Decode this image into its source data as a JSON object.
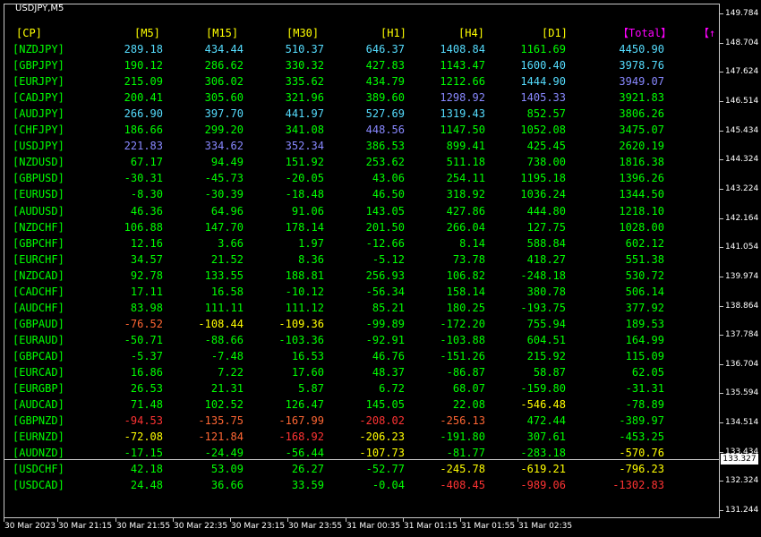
{
  "chart_title": "USDJPY,M5",
  "price_axis": [
    "149.784",
    "148.704",
    "147.624",
    "146.514",
    "145.434",
    "144.324",
    "143.224",
    "142.164",
    "141.054",
    "139.974",
    "138.864",
    "137.784",
    "136.704",
    "135.594",
    "134.514",
    "133.434",
    "132.324",
    "131.244"
  ],
  "current_price": "133.327",
  "time_axis": [
    "30 Mar 2023",
    "30 Mar 21:15",
    "30 Mar 21:55",
    "30 Mar 22:35",
    "30 Mar 23:15",
    "30 Mar 23:55",
    "31 Mar 00:35",
    "31 Mar 01:15",
    "31 Mar 01:55",
    "31 Mar 02:35"
  ],
  "table": {
    "headers": [
      "[CP]",
      "[M5]",
      "[M15]",
      "[M30]",
      "[H1]",
      "[H4]",
      "[D1]",
      "【Total】",
      "【↑"
    ],
    "header_colors": [
      "#ffff00",
      "#ffff00",
      "#ffff00",
      "#ffff00",
      "#ffff00",
      "#ffff00",
      "#ffff00",
      "#ff00ff",
      "#ff00ff"
    ],
    "rows": [
      {
        "pair": "[NZDJPY]",
        "v": [
          "289.18",
          "434.44",
          "510.37",
          "646.37",
          "1408.84",
          "1161.69",
          "4450.90"
        ],
        "c": [
          "#55ddff",
          "#55ddff",
          "#55ddff",
          "#55ddff",
          "#55ddff",
          "#00ff00",
          "#55ddff"
        ]
      },
      {
        "pair": "[GBPJPY]",
        "v": [
          "190.12",
          "286.62",
          "330.32",
          "427.83",
          "1143.47",
          "1600.40",
          "3978.76"
        ],
        "c": [
          "#00ff00",
          "#00ff00",
          "#00ff00",
          "#00ff00",
          "#00ff00",
          "#55ddff",
          "#55ddff"
        ]
      },
      {
        "pair": "[EURJPY]",
        "v": [
          "215.09",
          "306.02",
          "335.62",
          "434.79",
          "1212.66",
          "1444.90",
          "3949.07"
        ],
        "c": [
          "#00ff00",
          "#00ff00",
          "#00ff00",
          "#00ff00",
          "#00ff00",
          "#55ddff",
          "#8888ff"
        ]
      },
      {
        "pair": "[CADJPY]",
        "v": [
          "200.41",
          "305.60",
          "321.96",
          "389.60",
          "1298.92",
          "1405.33",
          "3921.83"
        ],
        "c": [
          "#00ff00",
          "#00ff00",
          "#00ff00",
          "#00ff00",
          "#8888ff",
          "#8888ff",
          "#00ff00"
        ]
      },
      {
        "pair": "[AUDJPY]",
        "v": [
          "266.90",
          "397.70",
          "441.97",
          "527.69",
          "1319.43",
          "852.57",
          "3806.26"
        ],
        "c": [
          "#55ddff",
          "#55ddff",
          "#55ddff",
          "#55ddff",
          "#55ddff",
          "#00ff00",
          "#00ff00"
        ]
      },
      {
        "pair": "[CHFJPY]",
        "v": [
          "186.66",
          "299.20",
          "341.08",
          "448.56",
          "1147.50",
          "1052.08",
          "3475.07"
        ],
        "c": [
          "#00ff00",
          "#00ff00",
          "#00ff00",
          "#8888ff",
          "#00ff00",
          "#00ff00",
          "#00ff00"
        ]
      },
      {
        "pair": "[USDJPY]",
        "v": [
          "221.83",
          "334.62",
          "352.34",
          "386.53",
          "899.41",
          "425.45",
          "2620.19"
        ],
        "c": [
          "#8888ff",
          "#8888ff",
          "#8888ff",
          "#00ff00",
          "#00ff00",
          "#00ff00",
          "#00ff00"
        ]
      },
      {
        "pair": "[NZDUSD]",
        "v": [
          "67.17",
          "94.49",
          "151.92",
          "253.62",
          "511.18",
          "738.00",
          "1816.38"
        ],
        "c": [
          "#00ff00",
          "#00ff00",
          "#00ff00",
          "#00ff00",
          "#00ff00",
          "#00ff00",
          "#00ff00"
        ]
      },
      {
        "pair": "[GBPUSD]",
        "v": [
          "-30.31",
          "-45.73",
          "-20.05",
          "43.06",
          "254.11",
          "1195.18",
          "1396.26"
        ],
        "c": [
          "#00ff00",
          "#00ff00",
          "#00ff00",
          "#00ff00",
          "#00ff00",
          "#00ff00",
          "#00ff00"
        ]
      },
      {
        "pair": "[EURUSD]",
        "v": [
          "-8.30",
          "-30.39",
          "-18.48",
          "46.50",
          "318.92",
          "1036.24",
          "1344.50"
        ],
        "c": [
          "#00ff00",
          "#00ff00",
          "#00ff00",
          "#00ff00",
          "#00ff00",
          "#00ff00",
          "#00ff00"
        ]
      },
      {
        "pair": "[AUDUSD]",
        "v": [
          "46.36",
          "64.96",
          "91.06",
          "143.05",
          "427.86",
          "444.80",
          "1218.10"
        ],
        "c": [
          "#00ff00",
          "#00ff00",
          "#00ff00",
          "#00ff00",
          "#00ff00",
          "#00ff00",
          "#00ff00"
        ]
      },
      {
        "pair": "[NZDCHF]",
        "v": [
          "106.88",
          "147.70",
          "178.14",
          "201.50",
          "266.04",
          "127.75",
          "1028.00"
        ],
        "c": [
          "#00ff00",
          "#00ff00",
          "#00ff00",
          "#00ff00",
          "#00ff00",
          "#00ff00",
          "#00ff00"
        ]
      },
      {
        "pair": "[GBPCHF]",
        "v": [
          "12.16",
          "3.66",
          "1.97",
          "-12.66",
          "8.14",
          "588.84",
          "602.12"
        ],
        "c": [
          "#00ff00",
          "#00ff00",
          "#00ff00",
          "#00ff00",
          "#00ff00",
          "#00ff00",
          "#00ff00"
        ]
      },
      {
        "pair": "[EURCHF]",
        "v": [
          "34.57",
          "21.52",
          "8.36",
          "-5.12",
          "73.78",
          "418.27",
          "551.38"
        ],
        "c": [
          "#00ff00",
          "#00ff00",
          "#00ff00",
          "#00ff00",
          "#00ff00",
          "#00ff00",
          "#00ff00"
        ]
      },
      {
        "pair": "[NZDCAD]",
        "v": [
          "92.78",
          "133.55",
          "188.81",
          "256.93",
          "106.82",
          "-248.18",
          "530.72"
        ],
        "c": [
          "#00ff00",
          "#00ff00",
          "#00ff00",
          "#00ff00",
          "#00ff00",
          "#00ff00",
          "#00ff00"
        ]
      },
      {
        "pair": "[CADCHF]",
        "v": [
          "17.11",
          "16.58",
          "-10.12",
          "-56.34",
          "158.14",
          "380.78",
          "506.14"
        ],
        "c": [
          "#00ff00",
          "#00ff00",
          "#00ff00",
          "#00ff00",
          "#00ff00",
          "#00ff00",
          "#00ff00"
        ]
      },
      {
        "pair": "[AUDCHF]",
        "v": [
          "83.98",
          "111.11",
          "111.12",
          "85.21",
          "180.25",
          "-193.75",
          "377.92"
        ],
        "c": [
          "#00ff00",
          "#00ff00",
          "#00ff00",
          "#00ff00",
          "#00ff00",
          "#00ff00",
          "#00ff00"
        ]
      },
      {
        "pair": "[GBPAUD]",
        "v": [
          "-76.52",
          "-108.44",
          "-109.36",
          "-99.89",
          "-172.20",
          "755.94",
          "189.53"
        ],
        "c": [
          "#ff6633",
          "#ffff00",
          "#ffff00",
          "#00ff00",
          "#00ff00",
          "#00ff00",
          "#00ff00"
        ]
      },
      {
        "pair": "[EURAUD]",
        "v": [
          "-50.71",
          "-88.66",
          "-103.36",
          "-92.91",
          "-103.88",
          "604.51",
          "164.99"
        ],
        "c": [
          "#00ff00",
          "#00ff00",
          "#00ff00",
          "#00ff00",
          "#00ff00",
          "#00ff00",
          "#00ff00"
        ]
      },
      {
        "pair": "[GBPCAD]",
        "v": [
          "-5.37",
          "-7.48",
          "16.53",
          "46.76",
          "-151.26",
          "215.92",
          "115.09"
        ],
        "c": [
          "#00ff00",
          "#00ff00",
          "#00ff00",
          "#00ff00",
          "#00ff00",
          "#00ff00",
          "#00ff00"
        ]
      },
      {
        "pair": "[EURCAD]",
        "v": [
          "16.86",
          "7.22",
          "17.60",
          "48.37",
          "-86.87",
          "58.87",
          "62.05"
        ],
        "c": [
          "#00ff00",
          "#00ff00",
          "#00ff00",
          "#00ff00",
          "#00ff00",
          "#00ff00",
          "#00ff00"
        ]
      },
      {
        "pair": "[EURGBP]",
        "v": [
          "26.53",
          "21.31",
          "5.87",
          "6.72",
          "68.07",
          "-159.80",
          "-31.31"
        ],
        "c": [
          "#00ff00",
          "#00ff00",
          "#00ff00",
          "#00ff00",
          "#00ff00",
          "#00ff00",
          "#00ff00"
        ]
      },
      {
        "pair": "[AUDCAD]",
        "v": [
          "71.48",
          "102.52",
          "126.47",
          "145.05",
          "22.08",
          "-546.48",
          "-78.89"
        ],
        "c": [
          "#00ff00",
          "#00ff00",
          "#00ff00",
          "#00ff00",
          "#00ff00",
          "#ffff00",
          "#00ff00"
        ]
      },
      {
        "pair": "[GBPNZD]",
        "v": [
          "-94.53",
          "-135.75",
          "-167.99",
          "-208.02",
          "-256.13",
          "472.44",
          "-389.97"
        ],
        "c": [
          "#ff3333",
          "#ff6633",
          "#ff6633",
          "#ff3333",
          "#ff6633",
          "#00ff00",
          "#00ff00"
        ]
      },
      {
        "pair": "[EURNZD]",
        "v": [
          "-72.08",
          "-121.84",
          "-168.92",
          "-206.23",
          "-191.80",
          "307.61",
          "-453.25"
        ],
        "c": [
          "#ffff00",
          "#ff6633",
          "#ff3333",
          "#ffff00",
          "#00ff00",
          "#00ff00",
          "#00ff00"
        ]
      },
      {
        "pair": "[AUDNZD]",
        "v": [
          "-17.15",
          "-24.49",
          "-56.44",
          "-107.73",
          "-81.77",
          "-283.18",
          "-570.76"
        ],
        "c": [
          "#00ff00",
          "#00ff00",
          "#00ff00",
          "#ffff00",
          "#00ff00",
          "#00ff00",
          "#ffff00"
        ]
      },
      {
        "pair": "[USDCHF]",
        "v": [
          "42.18",
          "53.09",
          "26.27",
          "-52.77",
          "-245.78",
          "-619.21",
          "-796.23"
        ],
        "c": [
          "#00ff00",
          "#00ff00",
          "#00ff00",
          "#00ff00",
          "#ffff00",
          "#ffff00",
          "#ffff00"
        ]
      },
      {
        "pair": "[USDCAD]",
        "v": [
          "24.48",
          "36.66",
          "33.59",
          "-0.04",
          "-408.45",
          "-989.06",
          "-1302.83"
        ],
        "c": [
          "#00ff00",
          "#00ff00",
          "#00ff00",
          "#00ff00",
          "#ff3333",
          "#ff3333",
          "#ff3333"
        ]
      }
    ]
  }
}
